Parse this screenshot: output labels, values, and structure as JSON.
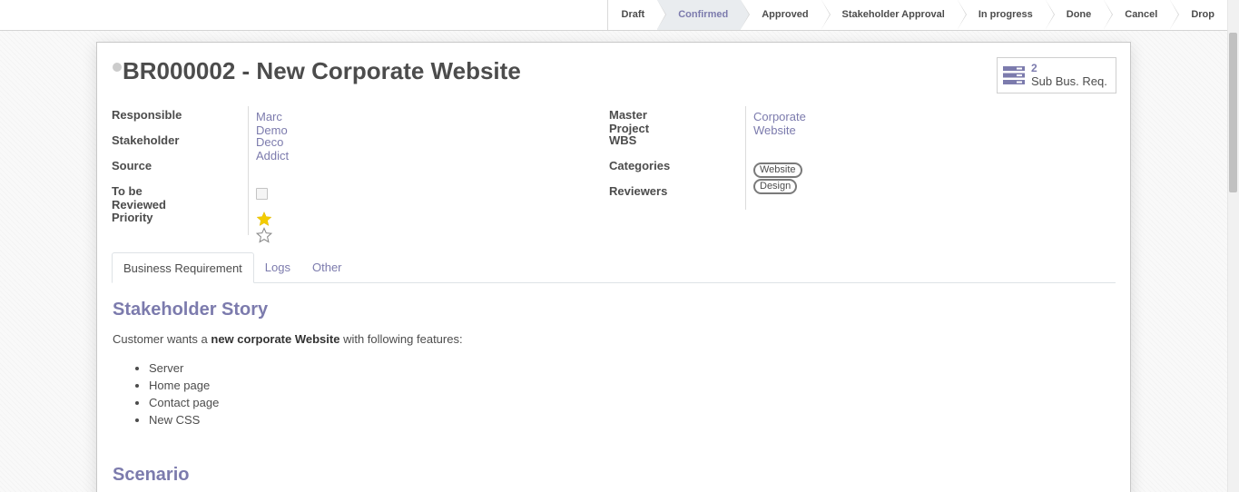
{
  "statusbar": {
    "stages": [
      "Draft",
      "Confirmed",
      "Approved",
      "Stakeholder Approval",
      "In progress",
      "Done",
      "Cancel",
      "Drop"
    ],
    "active_stage": "Confirmed"
  },
  "record": {
    "title": "BR000002 - New Corporate Website"
  },
  "smart_button": {
    "count": "2",
    "label": "Sub Bus. Req.",
    "icon": "list-stack-icon"
  },
  "fields_left": {
    "responsible_label": "Responsible",
    "responsible_value": "Marc Demo",
    "stakeholder_label": "Stakeholder",
    "stakeholder_value": "Deco Addict",
    "source_label": "Source",
    "to_be_reviewed_label": "To be Reviewed",
    "priority_label": "Priority",
    "priority_stars_filled": 1,
    "priority_stars_total": 2
  },
  "fields_right": {
    "master_project_label": "Master Project",
    "master_project_value": "Corporate Website",
    "wbs_label": "WBS",
    "categories_label": "Categories",
    "categories": [
      "Website",
      "Design"
    ],
    "reviewers_label": "Reviewers"
  },
  "tabs": [
    "Business Requirement",
    "Logs",
    "Other"
  ],
  "content": {
    "story_heading": "Stakeholder Story",
    "story_prefix": "Customer wants a ",
    "story_bold": "new corporate Website",
    "story_suffix": " with following features:",
    "features": [
      "Server",
      "Home page",
      "Contact page",
      "New CSS"
    ],
    "scenario_heading": "Scenario"
  },
  "colors": {
    "accent": "#7c7bad",
    "star": "#f3cc00",
    "text": "#4c4c4c"
  }
}
